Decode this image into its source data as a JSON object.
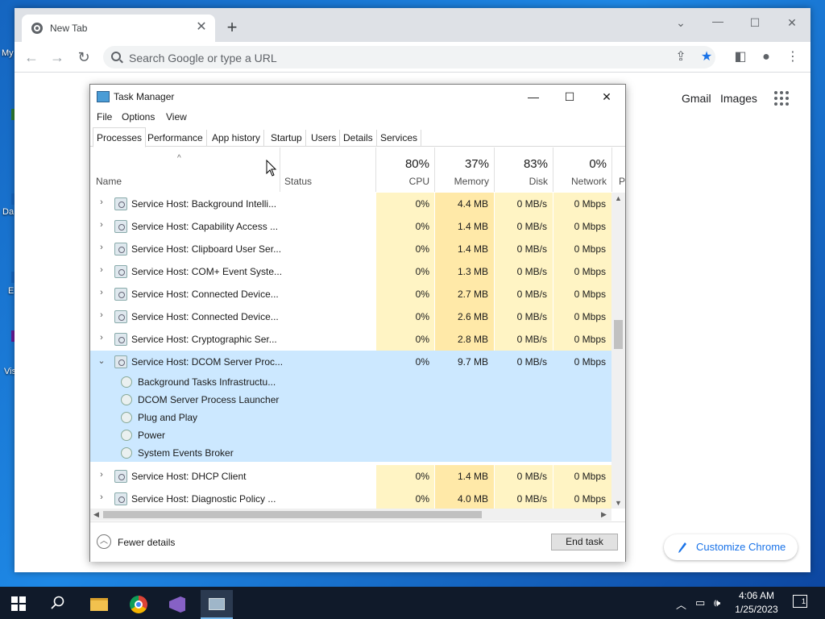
{
  "desktop": {
    "labels": [
      "My",
      "Da",
      "E",
      "Vis"
    ]
  },
  "chrome": {
    "tab_title": "New Tab",
    "omnibox_placeholder": "Search Google or type a URL",
    "links": {
      "gmail": "Gmail",
      "images": "Images"
    },
    "customize_label": "Customize Chrome"
  },
  "taskmanager": {
    "title": "Task Manager",
    "menu": [
      "File",
      "Options",
      "View"
    ],
    "tabs": [
      "Processes",
      "Performance",
      "App history",
      "Startup",
      "Users",
      "Details",
      "Services"
    ],
    "columns": {
      "name": "Name",
      "status": "Status",
      "cpu": {
        "pct": "80%",
        "label": "CPU"
      },
      "memory": {
        "pct": "37%",
        "label": "Memory"
      },
      "disk": {
        "pct": "83%",
        "label": "Disk"
      },
      "network": {
        "pct": "0%",
        "label": "Network"
      },
      "power": "P"
    },
    "rows": [
      {
        "name": "Service Host: Background Intelli...",
        "cpu": "0%",
        "memory": "4.4 MB",
        "disk": "0 MB/s",
        "network": "0 Mbps"
      },
      {
        "name": "Service Host: Capability Access ...",
        "cpu": "0%",
        "memory": "1.4 MB",
        "disk": "0 MB/s",
        "network": "0 Mbps"
      },
      {
        "name": "Service Host: Clipboard User Ser...",
        "cpu": "0%",
        "memory": "1.4 MB",
        "disk": "0 MB/s",
        "network": "0 Mbps"
      },
      {
        "name": "Service Host: COM+ Event Syste...",
        "cpu": "0%",
        "memory": "1.3 MB",
        "disk": "0 MB/s",
        "network": "0 Mbps"
      },
      {
        "name": "Service Host: Connected Device...",
        "cpu": "0%",
        "memory": "2.7 MB",
        "disk": "0 MB/s",
        "network": "0 Mbps"
      },
      {
        "name": "Service Host: Connected Device...",
        "cpu": "0%",
        "memory": "2.6 MB",
        "disk": "0 MB/s",
        "network": "0 Mbps"
      },
      {
        "name": "Service Host: Cryptographic Ser...",
        "cpu": "0%",
        "memory": "2.8 MB",
        "disk": "0 MB/s",
        "network": "0 Mbps"
      },
      {
        "name": "Service Host: DCOM Server Proc...",
        "cpu": "0%",
        "memory": "9.7 MB",
        "disk": "0 MB/s",
        "network": "0 Mbps"
      }
    ],
    "children": [
      "Background Tasks Infrastructu...",
      "DCOM Server Process Launcher",
      "Plug and Play",
      "Power",
      "System Events Broker"
    ],
    "rows_after": [
      {
        "name": "Service Host: DHCP Client",
        "cpu": "0%",
        "memory": "1.4 MB",
        "disk": "0 MB/s",
        "network": "0 Mbps"
      },
      {
        "name": "Service Host: Diagnostic Policy ...",
        "cpu": "0%",
        "memory": "4.0 MB",
        "disk": "0 MB/s",
        "network": "0 Mbps"
      }
    ],
    "fewer_details": "Fewer details",
    "end_task": "End task"
  },
  "taskbar": {
    "time": "4:06 AM",
    "date": "1/25/2023",
    "notifications": "1"
  },
  "colors": {
    "selection": "#cce8ff",
    "heat_light": "#fff4c4",
    "heat_mem": "#ffe9a8",
    "accent": "#1a73e8"
  }
}
